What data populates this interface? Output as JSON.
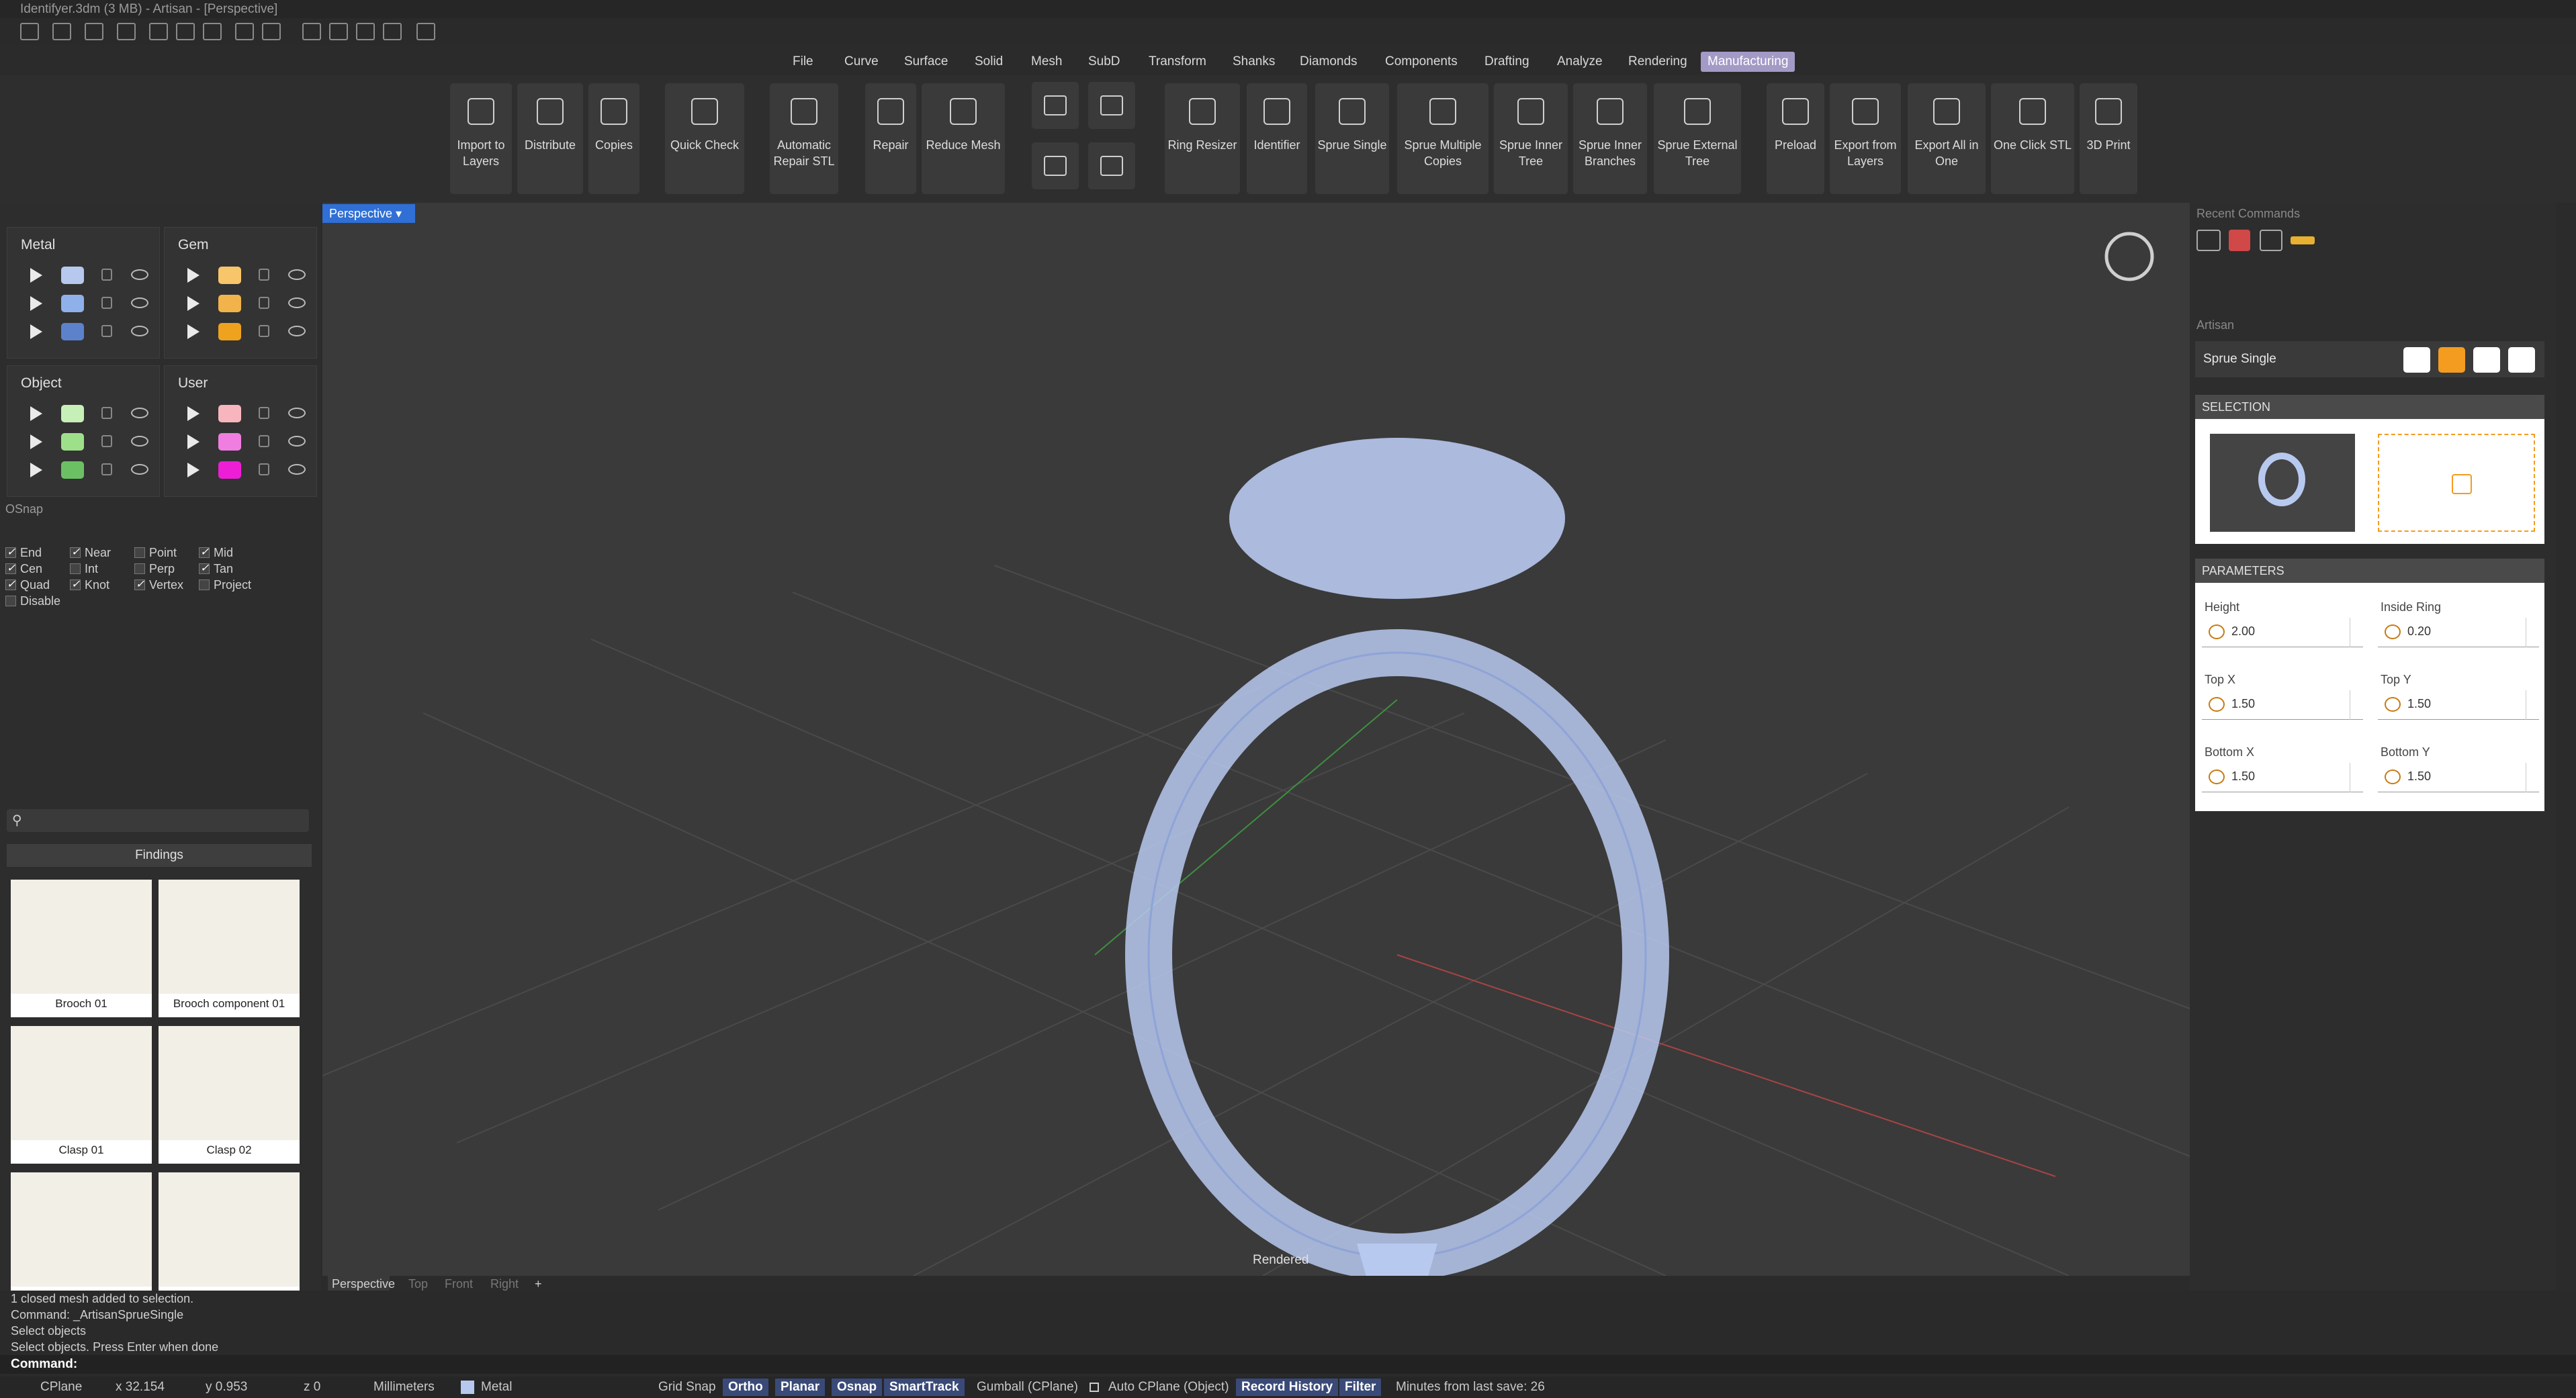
{
  "window": {
    "title": "Identifyer.3dm (3 MB) - Artisan - [Perspective]"
  },
  "menus": [
    "File",
    "Curve",
    "Surface",
    "Solid",
    "Mesh",
    "SubD",
    "Transform",
    "Shanks",
    "Diamonds",
    "Components",
    "Drafting",
    "Analyze",
    "Rendering",
    "Manufacturing"
  ],
  "active_menu": "Manufacturing",
  "ribbon": {
    "import": "Import to Layers",
    "distribute": "Distribute",
    "copies": "Copies",
    "quick_check": "Quick Check",
    "auto_repair_1": "Automatic",
    "auto_repair_2": "Repair STL",
    "repair": "Repair",
    "reduce_mesh": "Reduce Mesh",
    "ring_resizer": "Ring Resizer",
    "identifier": "Identifier",
    "sprue_single": "Sprue Single",
    "sprue_multi_1": "Sprue Multiple",
    "sprue_multi_2": "Copies",
    "sprue_inner_tree_1": "Sprue Inner",
    "sprue_inner_tree_2": "Tree",
    "sprue_inner_br_1": "Sprue Inner",
    "sprue_inner_br_2": "Branches",
    "sprue_ext_1": "Sprue External",
    "sprue_ext_2": "Tree",
    "preload": "Preload",
    "export_layers_1": "Export from",
    "export_layers_2": "Layers",
    "export_all_1": "Export All in",
    "export_all_2": "One",
    "one_click": "One Click STL",
    "print3d": "3D Print"
  },
  "layers": {
    "metal": {
      "title": "Metal",
      "colors": [
        "#b6c8ee",
        "#8fb0e8",
        "#5c82cc"
      ]
    },
    "gem": {
      "title": "Gem",
      "colors": [
        "#f7c56a",
        "#f2b34a",
        "#eea21e"
      ]
    },
    "object": {
      "title": "Object",
      "colors": [
        "#c7f0b8",
        "#9ee08a",
        "#6cc064"
      ]
    },
    "user": {
      "title": "User",
      "colors": [
        "#f7b6be",
        "#f07ee0",
        "#ee1ed6"
      ]
    }
  },
  "osnap": {
    "title": "OSnap",
    "items": [
      {
        "label": "End",
        "on": true
      },
      {
        "label": "Near",
        "on": true
      },
      {
        "label": "Point",
        "on": false
      },
      {
        "label": "Mid",
        "on": true
      },
      {
        "label": "Cen",
        "on": true
      },
      {
        "label": "Int",
        "on": false
      },
      {
        "label": "Perp",
        "on": false
      },
      {
        "label": "Tan",
        "on": true
      },
      {
        "label": "Quad",
        "on": true
      },
      {
        "label": "Knot",
        "on": true
      },
      {
        "label": "Vertex",
        "on": true
      },
      {
        "label": "Project",
        "on": false
      },
      {
        "label": "Disable",
        "on": false
      }
    ]
  },
  "library": {
    "category": "Findings",
    "items": [
      "Brooch 01",
      "Brooch component 01",
      "Clasp 01",
      "Clasp 02",
      "",
      ""
    ]
  },
  "viewport": {
    "name": "Perspective",
    "mode": "Rendered",
    "tabs": [
      "Perspective",
      "Top",
      "Front",
      "Right"
    ],
    "add": "+"
  },
  "right": {
    "recent": "Recent Commands",
    "artisan": "Artisan",
    "command": "Sprue Single",
    "selection": "SELECTION",
    "parameters": "PARAMETERS",
    "params": [
      {
        "label": "Height",
        "value": "2.00"
      },
      {
        "label": "Inside Ring",
        "value": "0.20"
      },
      {
        "label": "Top X",
        "value": "1.50"
      },
      {
        "label": "Top Y",
        "value": "1.50"
      },
      {
        "label": "Bottom X",
        "value": "1.50"
      },
      {
        "label": "Bottom Y",
        "value": "1.50"
      }
    ]
  },
  "command_history": [
    "1 closed mesh added to selection.",
    "Command: _ArtisanSprueSingle",
    "Select objects",
    "Select objects. Press Enter when done"
  ],
  "command_prompt": "Command:",
  "status": {
    "cplane": "CPlane",
    "x": "x 32.154",
    "y": "y 0.953",
    "z": "z 0",
    "units": "Millimeters",
    "layer": "Metal",
    "grid": "Grid Snap",
    "ortho": "Ortho",
    "planar": "Planar",
    "osnap": "Osnap",
    "smarttrack": "SmartTrack",
    "gumball": "Gumball (CPlane)",
    "autocplane": "Auto CPlane (Object)",
    "history": "Record History",
    "filter": "Filter",
    "save": "Minutes from last save: 26"
  },
  "colors": {
    "accent": "#2f6fd6",
    "orange": "#f39c1f",
    "ring": "#b8c9f0"
  }
}
